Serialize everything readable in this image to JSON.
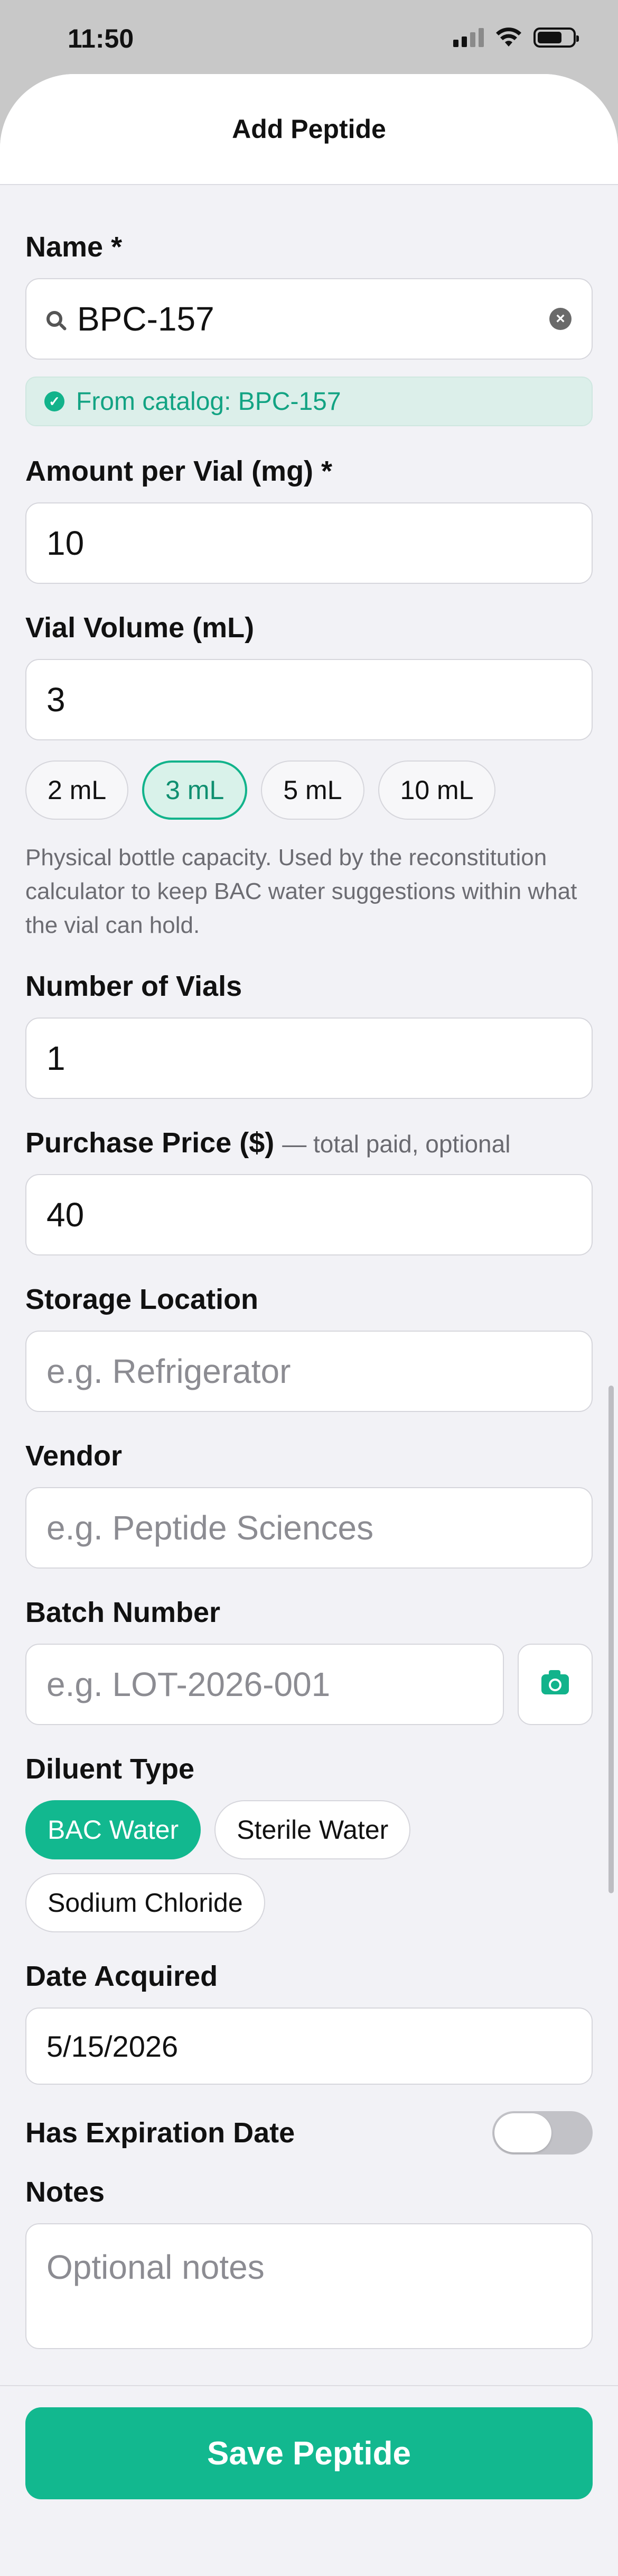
{
  "status_bar": {
    "time": "11:50"
  },
  "header": {
    "title": "Add Peptide"
  },
  "name": {
    "label": "Name *",
    "value": "BPC-157",
    "catalog_badge": "From catalog: BPC-157"
  },
  "amount": {
    "label": "Amount per Vial (mg) *",
    "value": "10"
  },
  "vial_volume": {
    "label": "Vial Volume (mL)",
    "value": "3",
    "options": [
      "2 mL",
      "3 mL",
      "5 mL",
      "10 mL"
    ],
    "selected": "3 mL",
    "helper": "Physical bottle capacity. Used by the reconstitution calculator to keep BAC water suggestions within what the vial can hold."
  },
  "vials": {
    "label": "Number of Vials",
    "value": "1"
  },
  "price": {
    "label": "Purchase Price ($)",
    "hint": "— total paid, optional",
    "value": "40"
  },
  "storage": {
    "label": "Storage Location",
    "placeholder": "e.g. Refrigerator"
  },
  "vendor": {
    "label": "Vendor",
    "placeholder": "e.g. Peptide Sciences"
  },
  "batch": {
    "label": "Batch Number",
    "placeholder": "e.g. LOT-2026-001"
  },
  "diluent": {
    "label": "Diluent Type",
    "options": [
      "BAC Water",
      "Sterile Water",
      "Sodium Chloride"
    ],
    "selected": "BAC Water"
  },
  "date_acquired": {
    "label": "Date Acquired",
    "value": "5/15/2026"
  },
  "expiration": {
    "label": "Has Expiration Date",
    "enabled": false
  },
  "notes": {
    "label": "Notes",
    "placeholder": "Optional notes"
  },
  "footer": {
    "save_label": "Save Peptide"
  },
  "colors": {
    "accent": "#12b88f",
    "accent_light": "#d9f2ea",
    "background": "#f2f2f6"
  },
  "icons": [
    "search-icon",
    "clear-icon",
    "check-circle-icon",
    "camera-icon",
    "wifi-icon",
    "battery-icon",
    "cellular-icon"
  ]
}
